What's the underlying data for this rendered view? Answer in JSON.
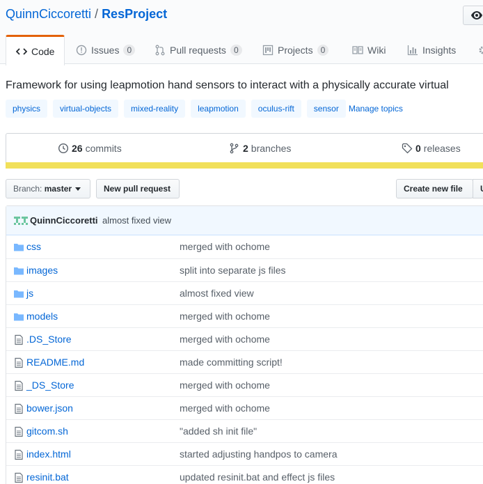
{
  "repo": {
    "owner": "QuinnCiccoretti",
    "separator": "/",
    "name": "ResProject"
  },
  "tabs": [
    {
      "label": "Code",
      "icon": "code-icon"
    },
    {
      "label": "Issues",
      "count": "0",
      "icon": "issue-icon"
    },
    {
      "label": "Pull requests",
      "count": "0",
      "icon": "pull-request-icon"
    },
    {
      "label": "Projects",
      "count": "0",
      "icon": "project-icon"
    },
    {
      "label": "Wiki",
      "icon": "book-icon"
    },
    {
      "label": "Insights",
      "icon": "graph-icon"
    }
  ],
  "description": "Framework for using leapmotion hand sensors to interact with a physically accurate virtual",
  "topics": [
    "physics",
    "virtual-objects",
    "mixed-reality",
    "leapmotion",
    "oculus-rift",
    "sensor"
  ],
  "manage_topics": "Manage topics",
  "summary": {
    "commits_count": "26",
    "commits_label": "commits",
    "branches_count": "2",
    "branches_label": "branches",
    "releases_count": "0",
    "releases_label": "releases"
  },
  "language_color": "#f1e05a",
  "buttons": {
    "branch_prefix": "Branch:",
    "branch_name": "master",
    "new_pull_request": "New pull request",
    "create_new_file": "Create new file",
    "upload_initial": "U"
  },
  "latest_commit": {
    "author": "QuinnCiccoretti",
    "message": "almost fixed view"
  },
  "files": [
    {
      "type": "dir",
      "name": "css",
      "message": "merged with ochome"
    },
    {
      "type": "dir",
      "name": "images",
      "message": "split into separate js files"
    },
    {
      "type": "dir",
      "name": "js",
      "message": "almost fixed view"
    },
    {
      "type": "dir",
      "name": "models",
      "message": "merged with ochome"
    },
    {
      "type": "file",
      "name": ".DS_Store",
      "message": "merged with ochome"
    },
    {
      "type": "file",
      "name": "README.md",
      "message": "made committing script!"
    },
    {
      "type": "file",
      "name": "_DS_Store",
      "message": "merged with ochome"
    },
    {
      "type": "file",
      "name": "bower.json",
      "message": "merged with ochome"
    },
    {
      "type": "file",
      "name": "gitcom.sh",
      "message": "\"added sh init file\""
    },
    {
      "type": "file",
      "name": "index.html",
      "message": "started adjusting handpos to camera"
    },
    {
      "type": "file",
      "name": "resinit.bat",
      "message": "updated resinit.bat and effect js files"
    }
  ]
}
